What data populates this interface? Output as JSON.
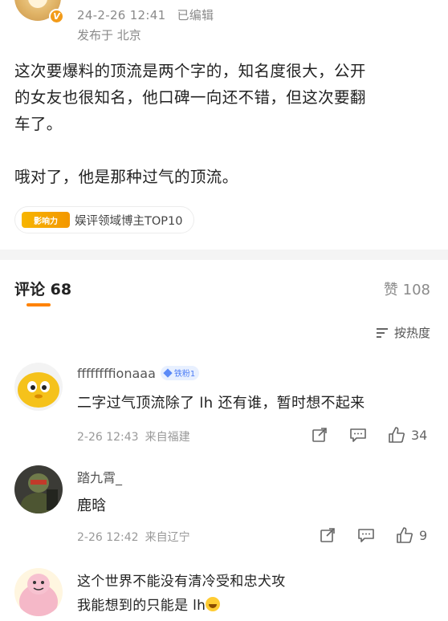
{
  "post": {
    "timestamp": "24-2-26 12:41",
    "edited_label": "已编辑",
    "location": "发布于 北京",
    "body_lines": [
      "这次要爆料的顶流是两个字的，知名度很大，公开",
      "的女友也很知名，他口碑一向还不错，但这次要翻",
      "车了。",
      "哦对了，他是那种过气的顶流。"
    ],
    "influence_logo_text": "影响力",
    "influence_label": "娱评领域博主TOP10"
  },
  "comments_header": {
    "comments_label": "评论 68",
    "likes_label": "赞 108",
    "sort_label": "按热度"
  },
  "comments": [
    {
      "username": "ffffffffionaaa",
      "fan_badge": "铁粉1",
      "text": "二字过气顶流除了 lh 还有谁，暂时想不起来",
      "time": "2-26 12:43",
      "from": "来自福建",
      "likes": "34"
    },
    {
      "username": "踏九霄_",
      "text": "鹿晗",
      "time": "2-26 12:42",
      "from": "来自辽宁",
      "likes": "9"
    },
    {
      "text_line1": "这个世界不能没有清冷受和忠犬攻",
      "text_line2": "我能想到的只能是 lh"
    }
  ],
  "colors": {
    "accent": "#ff8200",
    "muted": "#8a8a8a",
    "fan_badge": "#4c7cf5"
  }
}
